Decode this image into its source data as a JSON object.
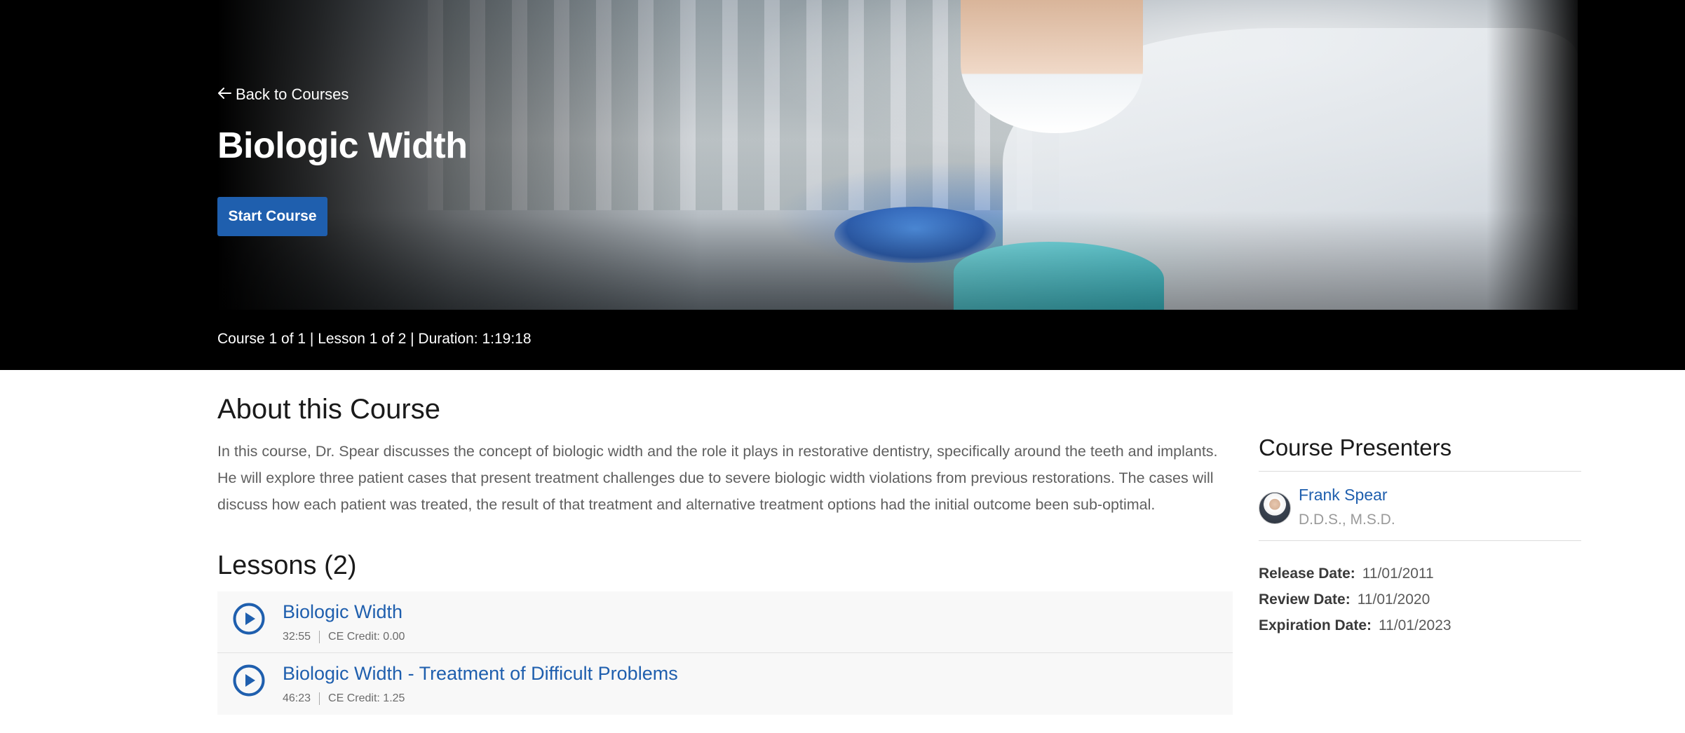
{
  "hero": {
    "back_label": "Back to Courses",
    "title": "Biologic Width",
    "start_label": "Start Course"
  },
  "meta_bar": {
    "text": "Course 1 of 1 | Lesson 1 of 2 | Duration: 1:19:18"
  },
  "about": {
    "title": "About this Course",
    "description": "In this course, Dr. Spear discusses the concept of biologic width and the role it plays in restorative dentistry, specifically around the teeth and implants. He will explore three patient cases that present treatment challenges due to severe biologic width violations from previous restorations. The cases will discuss how each patient was treated, the result of that treatment and alternative treatment options had the initial outcome been sub-optimal."
  },
  "lessons": {
    "title": "Lessons (2)",
    "items": [
      {
        "title": "Biologic Width",
        "duration": "32:55",
        "credit": "CE Credit: 0.00"
      },
      {
        "title": "Biologic Width - Treatment of Difficult Problems",
        "duration": "46:23",
        "credit": "CE Credit: 1.25"
      }
    ]
  },
  "presenters": {
    "title": "Course Presenters",
    "items": [
      {
        "name": "Frank Spear",
        "credentials": "D.D.S., M.S.D."
      }
    ]
  },
  "dates": {
    "release_label": "Release Date:",
    "release_value": "11/01/2011",
    "review_label": "Review Date:",
    "review_value": "11/01/2020",
    "expiration_label": "Expiration Date:",
    "expiration_value": "11/01/2023"
  },
  "icons": {
    "back": "arrow-left-icon",
    "play": "play-circle-icon"
  },
  "colors": {
    "accent": "#1f5fae",
    "hero_background": "#000000",
    "lesson_row_background": "#f8f8f8"
  }
}
